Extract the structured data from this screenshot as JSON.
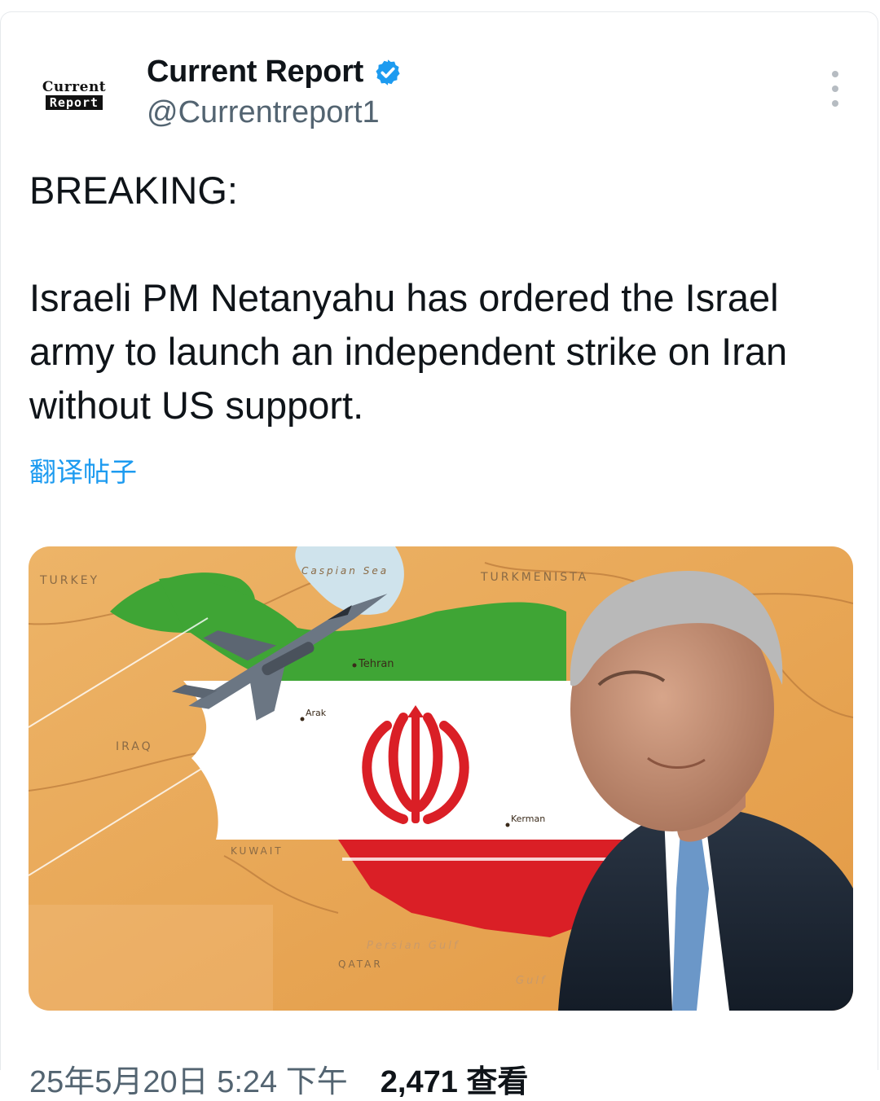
{
  "account": {
    "name": "Current Report",
    "handle": "@Currentreport1",
    "logo_top": "Current",
    "logo_bottom": "Report",
    "verified": true,
    "verified_color": "#1d9bf0"
  },
  "tweet": {
    "line1": "BREAKING:",
    "line2": "Israeli PM Netanyahu has ordered the Israel army to launch an independent strike on Iran without US support.",
    "translate_label": "翻译帖子"
  },
  "media": {
    "labels": {
      "turkey": "TURKEY",
      "caspian": "Caspian Sea",
      "turkmenistan": "TURKMENISTA",
      "tehran": "Tehran",
      "arak": "Arak",
      "iraq": "IRAQ",
      "kerman": "Kerman",
      "kuwait": "KUWAIT",
      "persian_gulf": "Persian Gulf",
      "qatar": "QATAR",
      "gulf": "Gulf"
    },
    "colors": {
      "green": "#3fa535",
      "red": "#da1f26",
      "sand": "#e9a957"
    }
  },
  "footer": {
    "datetime": "25年5月20日 5:24 下午",
    "views": "2,471 查看"
  },
  "icons": {
    "verified": "verified-badge-icon",
    "more": "more-dots-icon"
  }
}
